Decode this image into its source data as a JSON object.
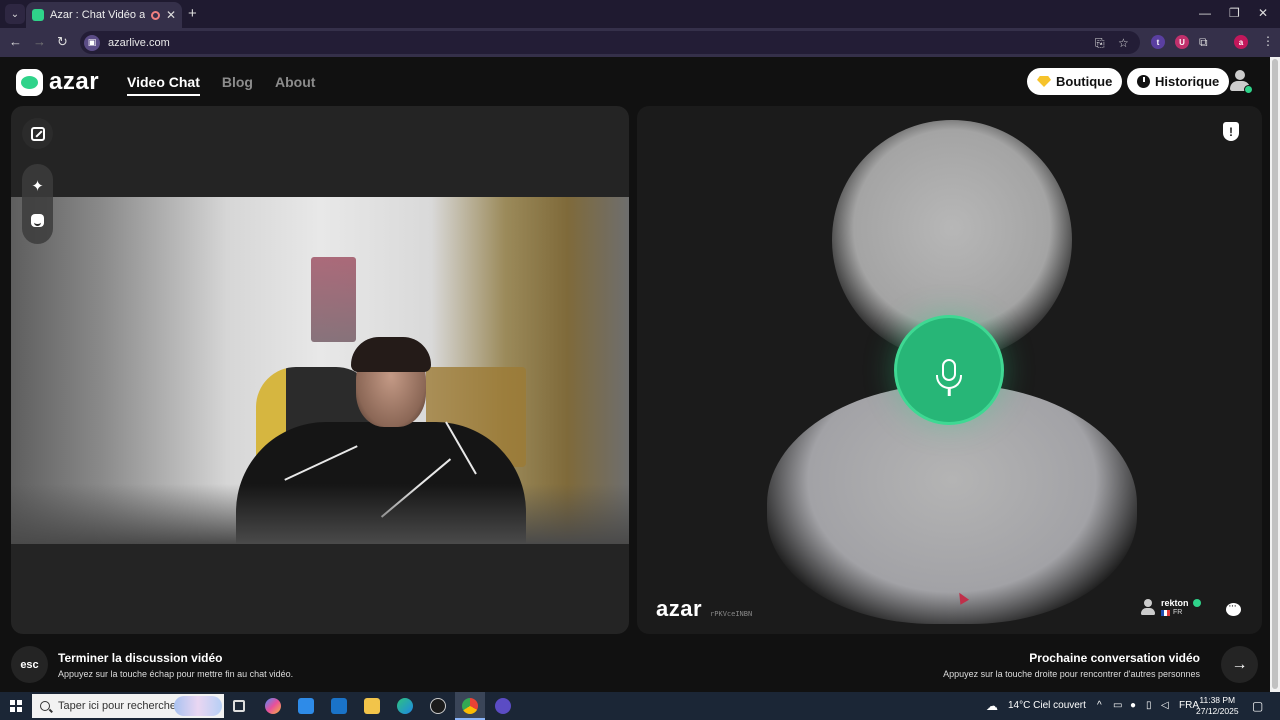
{
  "browser": {
    "tab_title": "Azar : Chat Vidéo avec de n",
    "url": "azarlive.com",
    "ext_t": "t",
    "ext_u": "U",
    "profile_initial": "a"
  },
  "header": {
    "logo_text": "azar",
    "nav": [
      {
        "label": "Video Chat",
        "active": true
      },
      {
        "label": "Blog",
        "active": false
      },
      {
        "label": "About",
        "active": false
      }
    ],
    "boutique_label": "Boutique",
    "historique_label": "Historique"
  },
  "partner": {
    "watermark_logo": "azar",
    "watermark_code": "rPKVceINBN",
    "name": "rekton",
    "country": "FR"
  },
  "footer": {
    "esc_label": "esc",
    "end_title": "Terminer la discussion vidéo",
    "end_sub": "Appuyez sur la touche échap pour mettre fin au chat vidéo.",
    "next_title": "Prochaine conversation vidéo",
    "next_sub": "Appuyez sur la touche droite pour rencontrer d'autres personnes",
    "next_arrow": "→"
  },
  "taskbar": {
    "search_placeholder": "Taper ici pour rechercher",
    "weather": "14°C  Ciel couvert",
    "language": "FRA",
    "time": "11:38 PM",
    "date": "27/12/2025"
  },
  "colors": {
    "brand_green": "#2fd38a",
    "background": "#111111",
    "panel": "#242424"
  }
}
